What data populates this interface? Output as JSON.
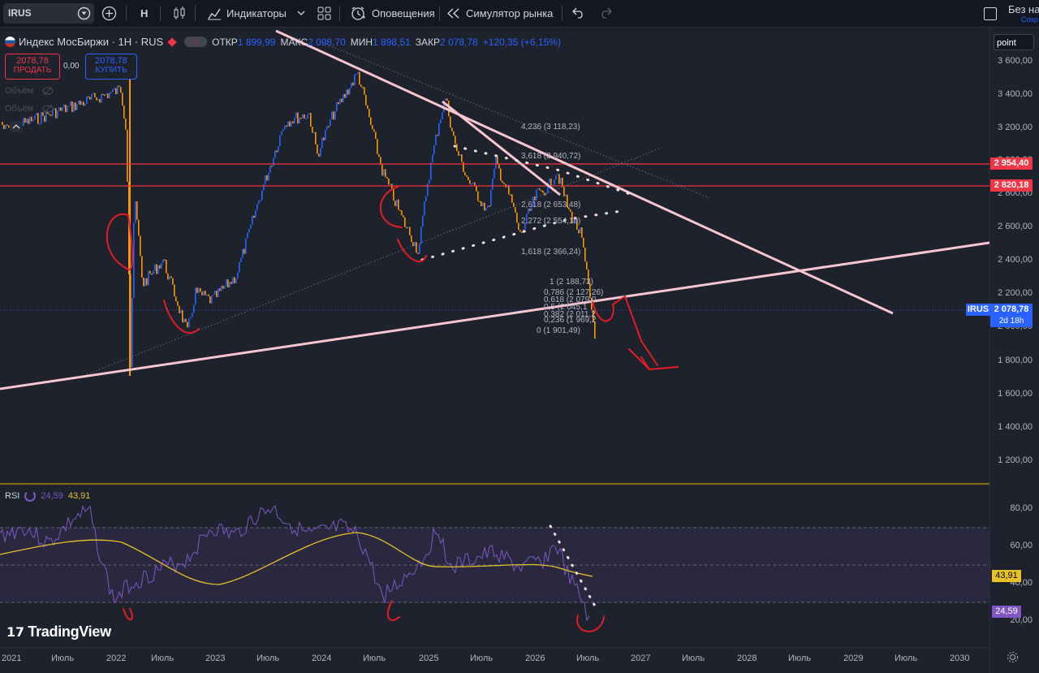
{
  "toolbar": {
    "symbol": "IRUS",
    "interval": "H",
    "indicators_label": "Индикаторы",
    "alerts_label": "Оповещения",
    "replay_label": "Симулятор рынка",
    "layout_label": "Без на",
    "layout_sub": "Сохр"
  },
  "legend": {
    "name": "Индекс МосБиржи · 1H · RUS",
    "open_label": "ОТКР",
    "open": "1 899,99",
    "high_label": "МАКС",
    "high": "2 098,70",
    "low_label": "МИН",
    "low": "1 898,51",
    "close_label": "ЗАКР",
    "close": "2 078,78",
    "change": "+120,35 (+6,15%)"
  },
  "trade": {
    "sell_price": "2078,78",
    "sell_label": "ПРОДАТЬ",
    "spread": "0,00",
    "buy_price": "2078,78",
    "buy_label": "КУПИТЬ"
  },
  "volume_labels": [
    "Объём",
    "Объём"
  ],
  "scale_mode": "point",
  "price_axis": [
    "3 600,00",
    "3 400,00",
    "3 200,00",
    "3 000,00",
    "2 800,00",
    "2 600,00",
    "2 400,00",
    "2 200,00",
    "2 000,00",
    "1 800,00",
    "1 600,00",
    "1 400,00",
    "1 200,00"
  ],
  "price_badges": {
    "level1": "2 954,40",
    "level2": "2 820,18",
    "current_symbol": "IRUS",
    "current_price": "2 078,78",
    "countdown": "2d 18h"
  },
  "fib_levels": [
    "4,236 (3 118,23)",
    "3,618 (2 940,72)",
    "2,618 (2 653,48)",
    "2,272 (2 554,10)",
    "1,618 (2 366,24)",
    "1 (2 188,73)",
    "0,786 (2 127,26)",
    "0,618 (2 079,0",
    "0,5 (2 045,1",
    "0,382 (2 011,2",
    "0,236 (1 969,2",
    "0 (1 901,49)"
  ],
  "rsi": {
    "label": "RSI",
    "value1": "24,59",
    "value2": "43,91",
    "axis": [
      "80,00",
      "60,00",
      "40,00",
      "20,00"
    ],
    "badge_ma": "43,91",
    "badge_rsi": "24,59"
  },
  "time_axis": [
    "2021",
    "Июль",
    "2022",
    "Июль",
    "2023",
    "Июль",
    "2024",
    "Июль",
    "2025",
    "Июль",
    "2026",
    "Июль",
    "2027",
    "Июль",
    "2028",
    "Июль",
    "2029",
    "Июль",
    "2030"
  ],
  "watermark": "TradingView",
  "colors": {
    "bg": "#1e222d",
    "up": "#2962ff",
    "down": "#ff9800",
    "levels": "#f23645",
    "trend": "#f8c6cf",
    "rsi_line": "#7e57c2",
    "rsi_ma": "#e6c229",
    "annotation": "#e31c25"
  }
}
